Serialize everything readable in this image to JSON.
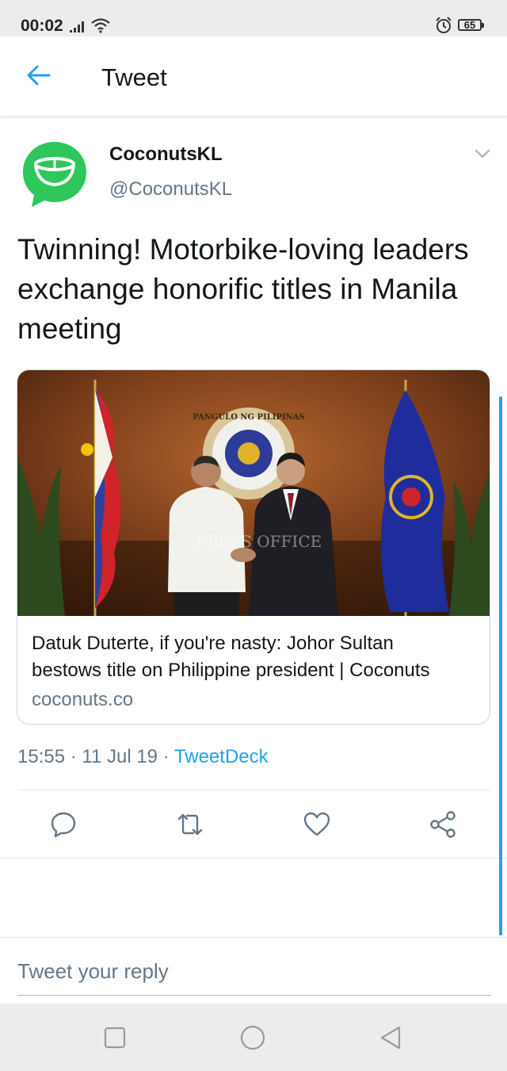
{
  "status_bar": {
    "time": "00:02",
    "battery": "65",
    "icons": [
      "signal-icon",
      "wifi-icon",
      "alarm-icon",
      "battery-icon"
    ]
  },
  "header": {
    "title": "Tweet",
    "back_icon": "arrow-left-icon"
  },
  "tweet": {
    "author": {
      "display_name": "CoconutsKL",
      "handle": "@CoconutsKL",
      "avatar_color": "#2fc65b"
    },
    "text": "Twinning! Motorbike-loving leaders exchange honorific titles in Manila meeting",
    "card": {
      "title_line1": "Datuk Duterte, if you're nasty: Johor Sultan",
      "title_line2": "bestows title on Philippine president | Coconuts",
      "domain": "coconuts.co",
      "image_watermark": "PRESS OFFICE",
      "image_seal_text": "PANGULO NG PILIPINAS"
    },
    "timestamp": "15:55 · 11 Jul 19 · ",
    "source": "TweetDeck",
    "actions": [
      "reply-icon",
      "retweet-icon",
      "like-icon",
      "share-icon"
    ]
  },
  "reply": {
    "placeholder": "Tweet your reply"
  },
  "colors": {
    "accent": "#1da1f2",
    "secondary_text": "#657786",
    "divider": "#e1e8ed"
  }
}
